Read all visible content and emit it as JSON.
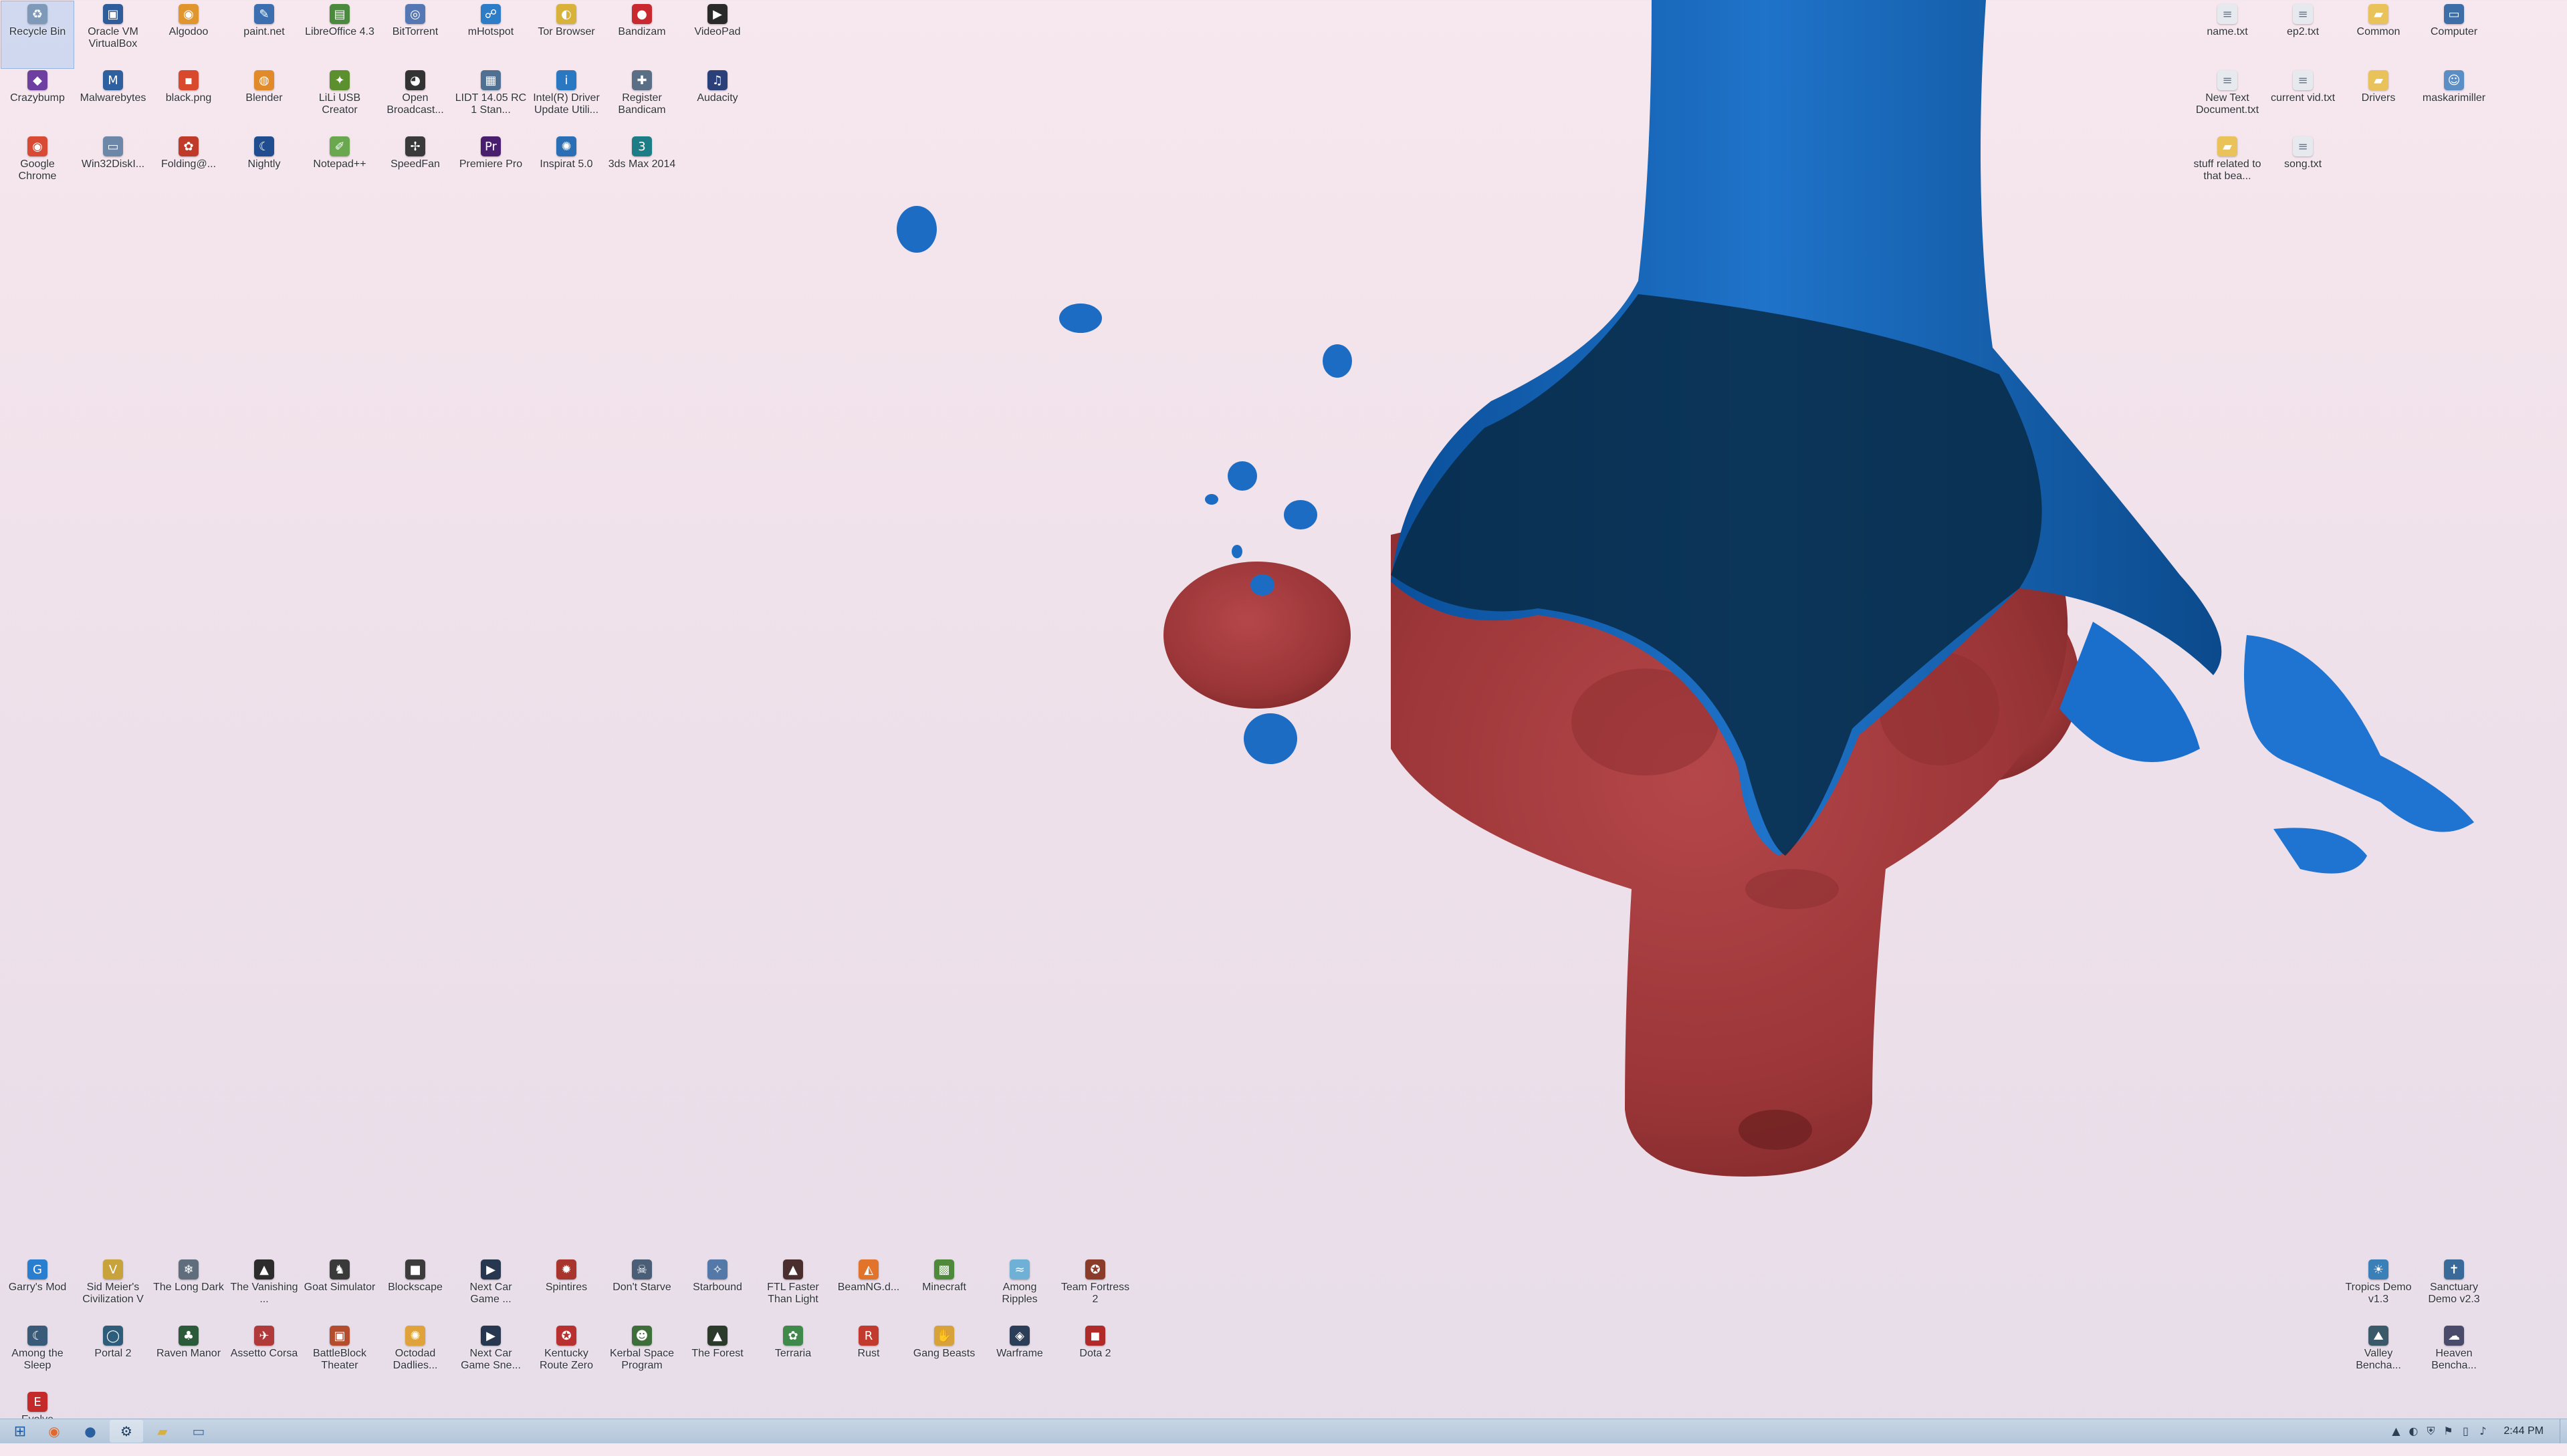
{
  "colors": {
    "monkey": "#a33a3c",
    "water": "#0b5fb4",
    "water_dark": "#082a45",
    "taskbar": "#bccde0"
  },
  "desktop": {
    "icons_top_left": [
      {
        "label": "Recycle Bin",
        "icon": "recycle-bin-icon",
        "glyph": "♻",
        "color": "#7e9ab8",
        "selected": true
      },
      {
        "label": "Oracle VM VirtualBox",
        "icon": "virtualbox-icon",
        "glyph": "▣",
        "color": "#2f5c9a"
      },
      {
        "label": "Algodoo",
        "icon": "algodoo-icon",
        "glyph": "◉",
        "color": "#e0962c"
      },
      {
        "label": "paint.net",
        "icon": "paintnet-icon",
        "glyph": "✎",
        "color": "#3c6fb0"
      },
      {
        "label": "LibreOffice 4.3",
        "icon": "libreoffice-icon",
        "glyph": "▤",
        "color": "#4a8a3c"
      },
      {
        "label": "BitTorrent",
        "icon": "bittorrent-icon",
        "glyph": "◎",
        "color": "#5578b4"
      },
      {
        "label": "mHotspot",
        "icon": "mhotspot-icon",
        "glyph": "☍",
        "color": "#2d7cc7"
      },
      {
        "label": "Tor Browser",
        "icon": "tor-browser-icon",
        "glyph": "◐",
        "color": "#d8b23a"
      },
      {
        "label": "Bandizam",
        "icon": "bandizam-icon",
        "glyph": "●",
        "color": "#c8282e"
      },
      {
        "label": "VideoPad",
        "icon": "videopad-icon",
        "glyph": "▶",
        "color": "#2a2a2a"
      },
      {
        "label": "Crazybump",
        "icon": "crazybump-icon",
        "glyph": "◆",
        "color": "#6c3fa0"
      },
      {
        "label": "Malwarebytes",
        "icon": "malwarebytes-icon",
        "glyph": "M",
        "color": "#2e5f9e"
      },
      {
        "label": "black.png",
        "icon": "image-file-icon",
        "glyph": "▪",
        "color": "#d9492e"
      },
      {
        "label": "Blender",
        "icon": "blender-icon",
        "glyph": "◍",
        "color": "#e08a2a"
      },
      {
        "label": "LiLi USB Creator",
        "icon": "lili-icon",
        "glyph": "✦",
        "color": "#5c8f2e"
      },
      {
        "label": "Open Broadcast...",
        "icon": "obs-icon",
        "glyph": "◕",
        "color": "#333333"
      },
      {
        "label": "LIDT 14.05 RC 1 Stan...",
        "icon": "lidt-icon",
        "glyph": "▦",
        "color": "#4f6f93"
      },
      {
        "label": "Intel(R) Driver Update Utili...",
        "icon": "intel-icon",
        "glyph": "i",
        "color": "#2a78c2"
      },
      {
        "label": "Register Bandicam",
        "icon": "register-icon",
        "glyph": "✚",
        "color": "#5a6f86"
      },
      {
        "label": "Audacity",
        "icon": "audacity-icon",
        "glyph": "♫",
        "color": "#2b3f78"
      },
      {
        "label": "Google Chrome",
        "icon": "chrome-icon",
        "glyph": "◉",
        "color": "#d84a34"
      },
      {
        "label": "Win32DiskI...",
        "icon": "disk-imager-icon",
        "glyph": "▭",
        "color": "#6d87a8"
      },
      {
        "label": "Folding@...",
        "icon": "folding-icon",
        "glyph": "✿",
        "color": "#c03a2a"
      },
      {
        "label": "Nightly",
        "icon": "nightly-icon",
        "glyph": "☾",
        "color": "#1f4d8f"
      },
      {
        "label": "Notepad++",
        "icon": "notepadpp-icon",
        "glyph": "✐",
        "color": "#6aa84f"
      },
      {
        "label": "SpeedFan",
        "icon": "speedfan-icon",
        "glyph": "✢",
        "color": "#3a3a3a"
      },
      {
        "label": "Premiere Pro",
        "icon": "premiere-icon",
        "glyph": "Pr",
        "color": "#4a1e6e"
      },
      {
        "label": "Inspirat 5.0",
        "icon": "inspirat-icon",
        "glyph": "✺",
        "color": "#2a6fb5"
      },
      {
        "label": "3ds Max 2014",
        "icon": "3dsmax-icon",
        "glyph": "3",
        "color": "#1d7d86"
      }
    ],
    "icons_top_right": [
      {
        "label": "name.txt",
        "icon": "text-file-icon",
        "glyph": "≡",
        "color": "#e6e9ee"
      },
      {
        "label": "ep2.txt",
        "icon": "text-file-icon",
        "glyph": "≡",
        "color": "#e6e9ee"
      },
      {
        "label": "Common",
        "icon": "folder-icon",
        "glyph": "▰",
        "color": "#e9c25a"
      },
      {
        "label": "Computer",
        "icon": "computer-icon",
        "glyph": "▭",
        "color": "#3e6ea8"
      },
      {
        "label": "New Text Document.txt",
        "icon": "text-file-icon",
        "glyph": "≡",
        "color": "#e6e9ee"
      },
      {
        "label": "current vid.txt",
        "icon": "text-file-icon",
        "glyph": "≡",
        "color": "#e6e9ee"
      },
      {
        "label": "Drivers",
        "icon": "folder-icon",
        "glyph": "▰",
        "color": "#e9c25a"
      },
      {
        "label": "maskarimiller",
        "icon": "user-folder-icon",
        "glyph": "☺",
        "color": "#5a8ec5"
      },
      {
        "label": "stuff related to that bea...",
        "icon": "folder-icon",
        "glyph": "▰",
        "color": "#e9c25a"
      },
      {
        "label": "song.txt",
        "icon": "text-file-icon",
        "glyph": "≡",
        "color": "#e6e9ee"
      }
    ],
    "icons_bottom_left": [
      {
        "label": "Garry's Mod",
        "icon": "garrys-mod-icon",
        "glyph": "G",
        "color": "#2a7ed0"
      },
      {
        "label": "Sid Meier's Civilization V",
        "icon": "civ5-icon",
        "glyph": "V",
        "color": "#c8a23a"
      },
      {
        "label": "The Long Dark",
        "icon": "long-dark-icon",
        "glyph": "❄",
        "color": "#5f6d7c"
      },
      {
        "label": "The Vanishing ...",
        "icon": "vanishing-icon",
        "glyph": "▲",
        "color": "#2c2c2c"
      },
      {
        "label": "Goat Simulator",
        "icon": "goat-icon",
        "glyph": "♞",
        "color": "#3a3a3a"
      },
      {
        "label": "Blockscape",
        "icon": "blockscape-icon",
        "glyph": "■",
        "color": "#3c3c3c"
      },
      {
        "label": "Next Car Game ...",
        "icon": "next-car-icon",
        "glyph": "▶",
        "color": "#26374f"
      },
      {
        "label": "Spintires",
        "icon": "spintires-icon",
        "glyph": "✹",
        "color": "#a8342e"
      },
      {
        "label": "Don't Starve",
        "icon": "dont-starve-icon",
        "glyph": "☠",
        "color": "#4a5e78"
      },
      {
        "label": "Starbound",
        "icon": "starbound-icon",
        "glyph": "✧",
        "color": "#5478a8"
      },
      {
        "label": "FTL Faster Than Light",
        "icon": "ftl-icon",
        "glyph": "▲",
        "color": "#4a2e2e"
      },
      {
        "label": "BeamNG.d...",
        "icon": "beamng-icon",
        "glyph": "◭",
        "color": "#e2732a"
      },
      {
        "label": "Minecraft",
        "icon": "minecraft-icon",
        "glyph": "▩",
        "color": "#4f8a3a"
      },
      {
        "label": "Among Ripples",
        "icon": "among-ripples-icon",
        "glyph": "≈",
        "color": "#6fb0d6"
      },
      {
        "label": "Team Fortress 2",
        "icon": "tf2-icon",
        "glyph": "✪",
        "color": "#8a3b2a"
      },
      {
        "label": "Among the Sleep",
        "icon": "among-sleep-icon",
        "glyph": "☾",
        "color": "#3a5a7a"
      },
      {
        "label": "Portal 2",
        "icon": "portal2-icon",
        "glyph": "◯",
        "color": "#2d5d7a"
      },
      {
        "label": "Raven Manor",
        "icon": "raven-manor-icon",
        "glyph": "♣",
        "color": "#2a5a3a"
      },
      {
        "label": "Assetto Corsa",
        "icon": "assetto-icon",
        "glyph": "✈",
        "color": "#b03a3a"
      },
      {
        "label": "BattleBlock Theater",
        "icon": "battleblock-icon",
        "glyph": "▣",
        "color": "#b44c2e"
      },
      {
        "label": "Octodad Dadlies...",
        "icon": "octodad-icon",
        "glyph": "✺",
        "color": "#e0a23a"
      },
      {
        "label": "Next Car Game Sne...",
        "icon": "next-car-sneak-icon",
        "glyph": "▶",
        "color": "#26374f"
      },
      {
        "label": "Kentucky Route Zero",
        "icon": "kentucky-icon",
        "glyph": "✪",
        "color": "#b83030"
      },
      {
        "label": "Kerbal Space Program",
        "icon": "ksp-icon",
        "glyph": "☻",
        "color": "#3e6e3a"
      },
      {
        "label": "The Forest",
        "icon": "forest-icon",
        "glyph": "▲",
        "color": "#2c3a2c"
      },
      {
        "label": "Terraria",
        "icon": "terraria-icon",
        "glyph": "✿",
        "color": "#3f8a4a"
      },
      {
        "label": "Rust",
        "icon": "rust-icon",
        "glyph": "R",
        "color": "#c23a2e"
      },
      {
        "label": "Gang Beasts",
        "icon": "gang-beasts-icon",
        "glyph": "✋",
        "color": "#d8a23a"
      },
      {
        "label": "Warframe",
        "icon": "warframe-icon",
        "glyph": "◈",
        "color": "#2c3d58"
      },
      {
        "label": "Dota 2",
        "icon": "dota2-icon",
        "glyph": "◼",
        "color": "#b02a2a"
      },
      {
        "label": "Evolve",
        "icon": "evolve-icon",
        "glyph": "E",
        "color": "#c42a2a"
      }
    ],
    "icons_bottom_right": [
      {
        "label": "Tropics Demo v1.3",
        "icon": "tropics-icon",
        "glyph": "☀",
        "color": "#3a7fb8"
      },
      {
        "label": "Sanctuary Demo v2.3",
        "icon": "sanctuary-icon",
        "glyph": "✝",
        "color": "#3a6a9a"
      },
      {
        "label": "Valley Bencha...",
        "icon": "valley-icon",
        "glyph": "⛰",
        "color": "#3a5a6a"
      },
      {
        "label": "Heaven Bencha...",
        "icon": "heaven-icon",
        "glyph": "☁",
        "color": "#4a4a6a"
      }
    ]
  },
  "taskbar": {
    "buttons": [
      {
        "name": "firefox-icon",
        "glyph": "◉",
        "color": "#e2682a"
      },
      {
        "name": "chrome-taskbar-icon",
        "glyph": "●",
        "color": "#2a5fa0"
      },
      {
        "name": "steam-icon",
        "glyph": "⚙",
        "color": "#1d3c5e",
        "active": true
      },
      {
        "name": "file-explorer-icon",
        "glyph": "▰",
        "color": "#d8b040"
      },
      {
        "name": "app-window-icon",
        "glyph": "▭",
        "color": "#3b6da3"
      }
    ],
    "tray": [
      {
        "name": "tray-overflow-icon",
        "glyph": "▲"
      },
      {
        "name": "network-activity-icon",
        "glyph": "◐"
      },
      {
        "name": "security-icon",
        "glyph": "⛨"
      },
      {
        "name": "flag-icon",
        "glyph": "⚑"
      },
      {
        "name": "power-icon",
        "glyph": "▯"
      },
      {
        "name": "volume-icon",
        "glyph": "♪"
      }
    ],
    "clock": "2:44 PM"
  }
}
